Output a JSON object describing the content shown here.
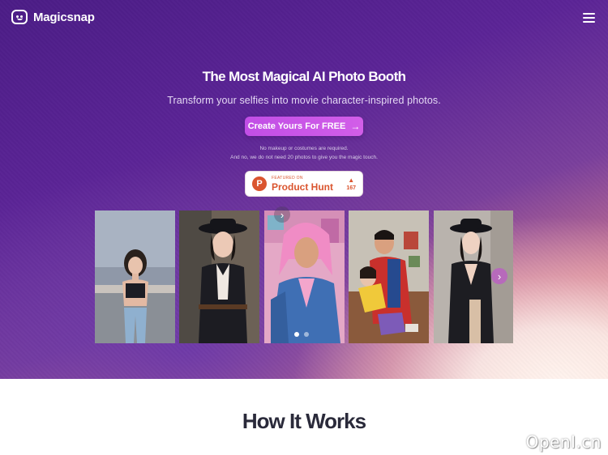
{
  "brand": {
    "name": "Magicsnap",
    "logo_icon": "smile-box-icon"
  },
  "nav": {
    "menu_icon": "hamburger-menu-icon"
  },
  "hero": {
    "title": "The Most Magical AI Photo Booth",
    "subtitle": "Transform your selfies into movie character-inspired photos.",
    "cta_label": "Create Yours For FREE",
    "cta_icon": "arrow-right-icon",
    "note_line1": "No makeup or costumes are required.",
    "note_line2": "And no, we do not need 20 photos to give you the magic touch."
  },
  "product_hunt": {
    "featured_label": "FEATURED ON",
    "name": "Product Hunt",
    "logo_letter": "P",
    "upvote_icon": "triangle-up-icon",
    "votes": "167"
  },
  "gallery": {
    "photos": [
      {
        "name": "photo-woman-jeans"
      },
      {
        "name": "photo-woman-black-hat"
      },
      {
        "name": "photo-man-pink-hair"
      },
      {
        "name": "photo-cartoon-couple"
      },
      {
        "name": "photo-woman-black-dress"
      }
    ],
    "prev_icon": "chevron-right-icon",
    "next_icon": "chevron-right-icon",
    "dots": 2,
    "active_dot": 1
  },
  "section": {
    "how_title": "How It Works"
  },
  "watermark": "OpenI.cn",
  "colors": {
    "accent": "#c14ee6",
    "hunt": "#da552f",
    "hero_top": "#4b1c86"
  }
}
